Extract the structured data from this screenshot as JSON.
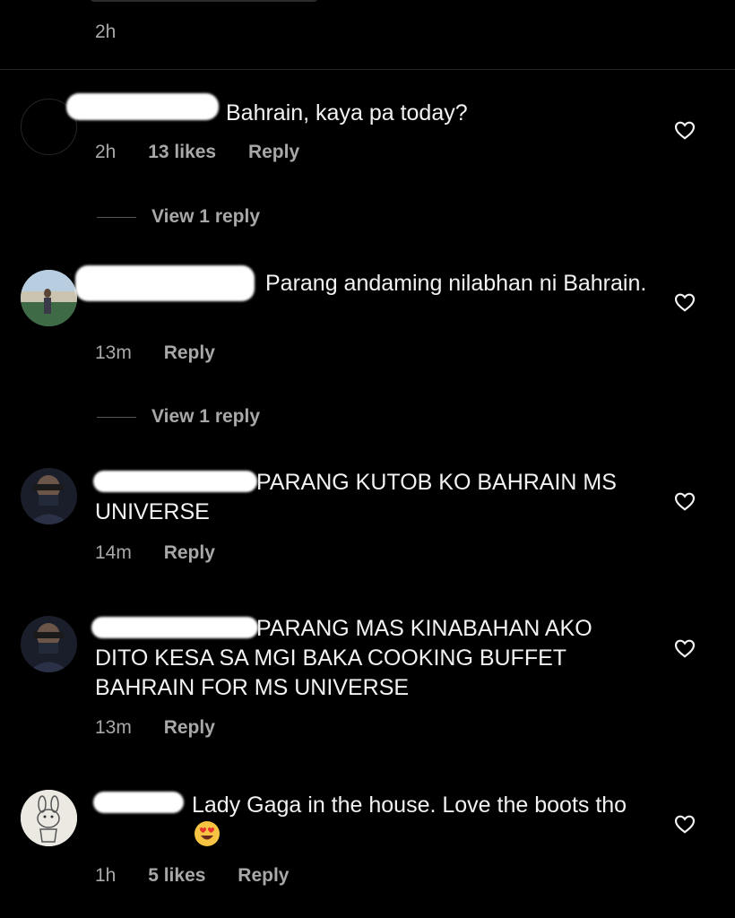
{
  "top": {
    "time": "2h"
  },
  "comments": [
    {
      "text": "Bahrain, kaya pa today?",
      "time": "2h",
      "likes": "13 likes",
      "reply_label": "Reply",
      "view_replies": "View 1 reply"
    },
    {
      "text": "Parang andaming nilabhan ni Bahrain.",
      "time": "13m",
      "reply_label": "Reply",
      "view_replies": "View 1 reply"
    },
    {
      "text": "PARANG KUTOB KO BAHRAIN MS UNIVERSE",
      "time": "14m",
      "reply_label": "Reply"
    },
    {
      "text": "PARANG MAS KINABAHAN AKO DITO KESA SA MGI BAKA  COOKING BUFFET BAHRAIN FOR MS UNIVERSE",
      "time": "13m",
      "reply_label": "Reply"
    },
    {
      "text": "Lady Gaga in the house. Love the boots tho",
      "emoji": "heart-eyes-emoji",
      "time": "1h",
      "likes": "5 likes",
      "reply_label": "Reply"
    }
  ],
  "colors": {
    "background": "#000000",
    "text": "#f2f2f2",
    "muted": "#a8a8a8"
  }
}
